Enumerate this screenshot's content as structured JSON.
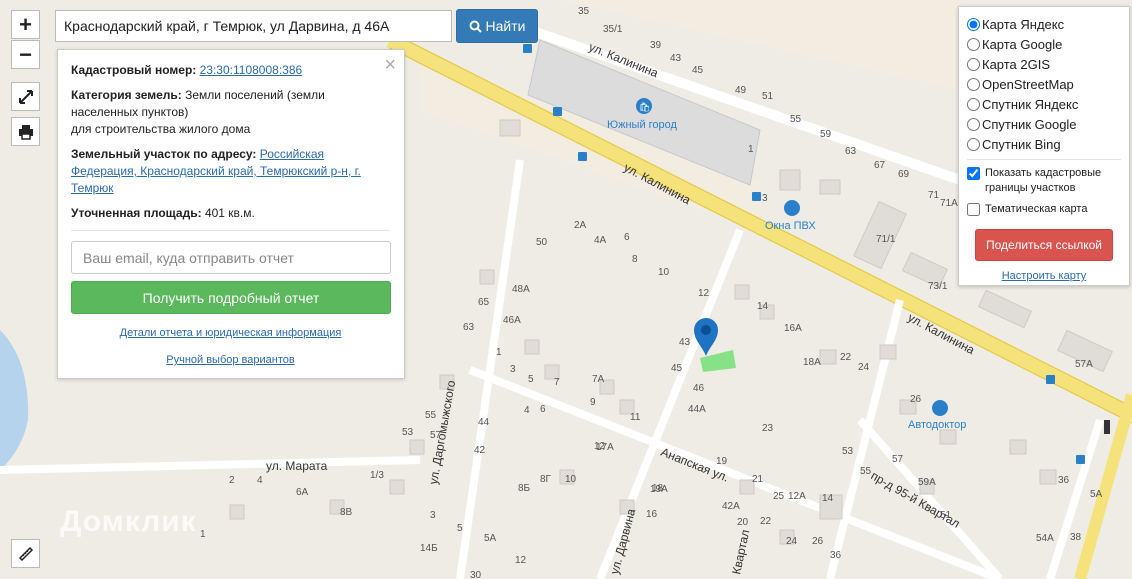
{
  "search": {
    "value": "Краснодарский край, г Темрюк, ул Дарвина, д 46А",
    "button_label": "Найти"
  },
  "controls": {
    "zoom_in": "+",
    "zoom_out": "−"
  },
  "info": {
    "cadastral_label": "Кадастровый номер:",
    "cadastral_value": "23:30:1108008:386",
    "category_label": "Категория земель:",
    "category_value": "Земли поселений (земли населенных пунктов)",
    "category_purpose": "для строительства жилого дома",
    "address_label": "Земельный участок по адресу:",
    "address_value": "Российская Федерация, Краснодарский край, Темрюкский р-н, г. Темрюк",
    "area_label": "Уточненная площадь:",
    "area_value": "401 кв.м.",
    "email_placeholder": "Ваш email, куда отправить отчет",
    "report_button": "Получить подробный отчет",
    "details_link": "Детали отчета и юридическая информация",
    "manual_link": "Ручной выбор вариантов",
    "close": "×"
  },
  "layers": {
    "options": [
      {
        "label": "Карта Яндекс",
        "checked": true
      },
      {
        "label": "Карта Google",
        "checked": false
      },
      {
        "label": "Карта 2GIS",
        "checked": false
      },
      {
        "label": "OpenStreetMap",
        "checked": false
      },
      {
        "label": "Спутник Яндекс",
        "checked": false
      },
      {
        "label": "Спутник Google",
        "checked": false
      },
      {
        "label": "Спутник Bing",
        "checked": false
      }
    ],
    "show_borders": "Показать кадастровые границы участков",
    "show_borders_checked": true,
    "thematic": "Тематическая карта",
    "thematic_checked": false,
    "share_button": "Поделиться ссылкой",
    "configure_link": "Настроить карту"
  },
  "map": {
    "streets": {
      "kalinina_1": "ул. Калинина",
      "kalinina_2": "ул. Калинина",
      "kalinina_3": "ул. Калинина",
      "marata": "ул. Марата",
      "dargomyzhskogo": "ул. Даргомыжского",
      "anapskaya": "Анапская ул.",
      "darvina": "ул. Дарвина",
      "kvartal": "пр-д 95-й Квартал",
      "kvartal2": "Квартал"
    },
    "pois": {
      "yuzhny": "Южный город",
      "okna": "Окна ПВХ",
      "avtodoktor": "Автодоктор"
    },
    "house_numbers": [
      "35",
      "35/1",
      "39",
      "43",
      "45",
      "49",
      "51",
      "55",
      "59",
      "63",
      "67",
      "69",
      "71",
      "71А",
      "73/1",
      "71/1",
      "1",
      "3",
      "2А",
      "4А",
      "6",
      "50",
      "8",
      "10",
      "12",
      "48А",
      "65",
      "63",
      "46А",
      "1",
      "43",
      "14",
      "16А",
      "18А",
      "22",
      "24",
      "26",
      "45",
      "46",
      "44А",
      "3",
      "5",
      "7",
      "7А",
      "9",
      "11",
      "4",
      "6",
      "55",
      "57",
      "53",
      "44",
      "42",
      "2",
      "4",
      "6А",
      "8В",
      "1/3",
      "8Б",
      "8Г",
      "10",
      "12",
      "17А",
      "19А",
      "19",
      "21",
      "23",
      "25",
      "12А",
      "14",
      "18",
      "42А",
      "16",
      "20",
      "22",
      "24",
      "26",
      "36",
      "1",
      "3",
      "5",
      "5А",
      "12",
      "14Б",
      "30",
      "51",
      "53",
      "55",
      "57",
      "59А",
      "36",
      "5А",
      "57А",
      "54А",
      "38"
    ],
    "watermark": "Домклик"
  }
}
